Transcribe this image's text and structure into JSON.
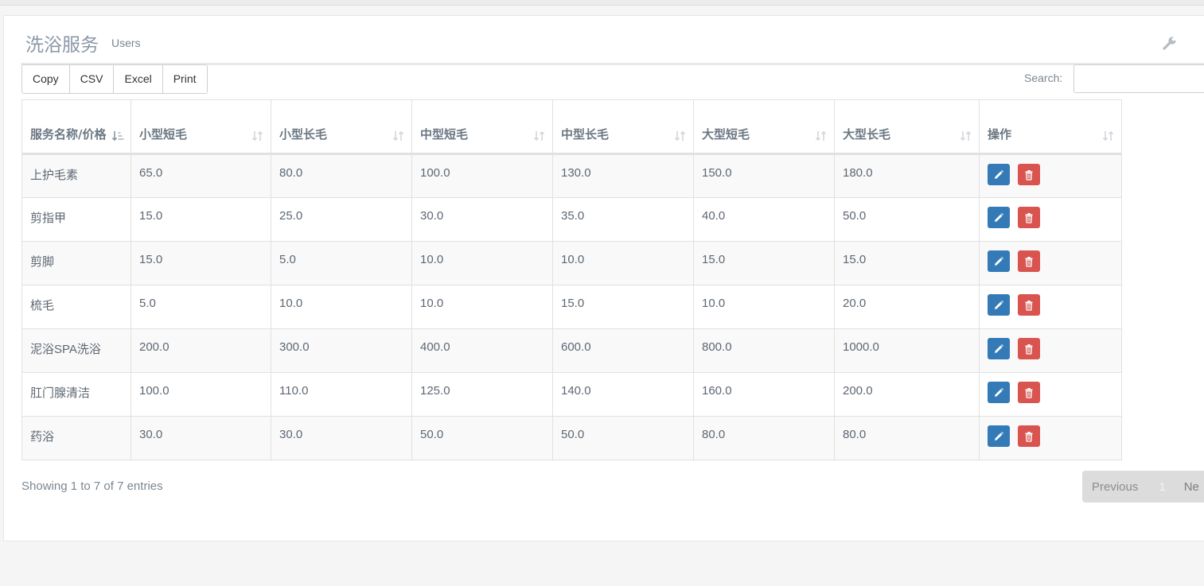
{
  "header": {
    "title": "洗浴服务",
    "subtitle": "Users"
  },
  "toolbar": {
    "copy": "Copy",
    "csv": "CSV",
    "excel": "Excel",
    "print": "Print",
    "search_label": "Search:",
    "search_value": ""
  },
  "table": {
    "columns": [
      "服务名称/价格",
      "小型短毛",
      "小型长毛",
      "中型短毛",
      "中型长毛",
      "大型短毛",
      "大型长毛",
      "操作"
    ],
    "rows": [
      [
        "上护毛素",
        "65.0",
        "80.0",
        "100.0",
        "130.0",
        "150.0",
        "180.0"
      ],
      [
        "剪指甲",
        "15.0",
        "25.0",
        "30.0",
        "35.0",
        "40.0",
        "50.0"
      ],
      [
        "剪脚",
        "15.0",
        "5.0",
        "10.0",
        "10.0",
        "15.0",
        "15.0"
      ],
      [
        "梳毛",
        "5.0",
        "10.0",
        "10.0",
        "15.0",
        "10.0",
        "20.0"
      ],
      [
        "泥浴SPA洗浴",
        "200.0",
        "300.0",
        "400.0",
        "600.0",
        "800.0",
        "1000.0"
      ],
      [
        "肛门腺清洁",
        "100.0",
        "110.0",
        "125.0",
        "140.0",
        "160.0",
        "200.0"
      ],
      [
        "药浴",
        "30.0",
        "30.0",
        "50.0",
        "50.0",
        "80.0",
        "80.0"
      ]
    ]
  },
  "footer": {
    "info": "Showing 1 to 7 of 7 entries",
    "previous": "Previous",
    "current_page": "1",
    "next": "Ne"
  },
  "colors": {
    "edit_button": "#337ab7",
    "delete_button": "#d9534f"
  }
}
